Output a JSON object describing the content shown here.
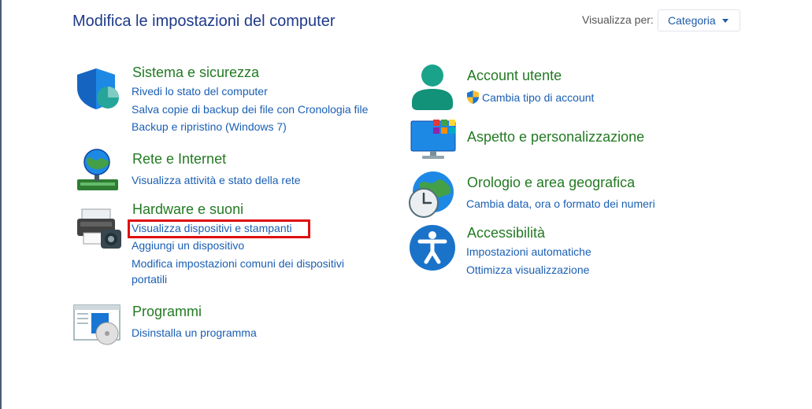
{
  "header": {
    "title": "Modifica le impostazioni del computer",
    "view_by_label": "Visualizza per:",
    "view_by_value": "Categoria"
  },
  "categories": {
    "sistema": {
      "title": "Sistema e sicurezza",
      "links": [
        "Rivedi lo stato del computer",
        "Salva copie di backup dei file con Cronologia file",
        "Backup e ripristino (Windows 7)"
      ]
    },
    "rete": {
      "title": "Rete e Internet",
      "links": [
        "Visualizza attività e stato della rete"
      ]
    },
    "hardware": {
      "title": "Hardware e suoni",
      "links": [
        "Visualizza dispositivi e stampanti",
        "Aggiungi un dispositivo",
        "Modifica impostazioni comuni dei dispositivi",
        "portatili"
      ]
    },
    "programmi": {
      "title": "Programmi",
      "links": [
        "Disinstalla un programma"
      ]
    },
    "account": {
      "title": "Account utente",
      "links": [
        "Cambia tipo di account"
      ]
    },
    "aspetto": {
      "title": "Aspetto e personalizzazione",
      "links": []
    },
    "orologio": {
      "title": "Orologio e area geografica",
      "links": [
        "Cambia data, ora o formato dei numeri"
      ]
    },
    "accessibilita": {
      "title": "Accessibilità",
      "links": [
        "Impostazioni automatiche",
        "Ottimizza visualizzazione"
      ]
    }
  },
  "icons": {
    "sistema": "shield-icon",
    "rete": "network-globe-icon",
    "hardware": "printer-icon",
    "programmi": "programs-disc-icon",
    "account": "user-icon",
    "aspetto": "monitor-icon",
    "orologio": "clock-globe-icon",
    "accessibilita": "accessibility-icon",
    "uac": "uac-shield-icon"
  },
  "colors": {
    "title": "#1e3a8a",
    "category": "#237a23",
    "link": "#1a5fb4",
    "highlight": "#e01010"
  }
}
